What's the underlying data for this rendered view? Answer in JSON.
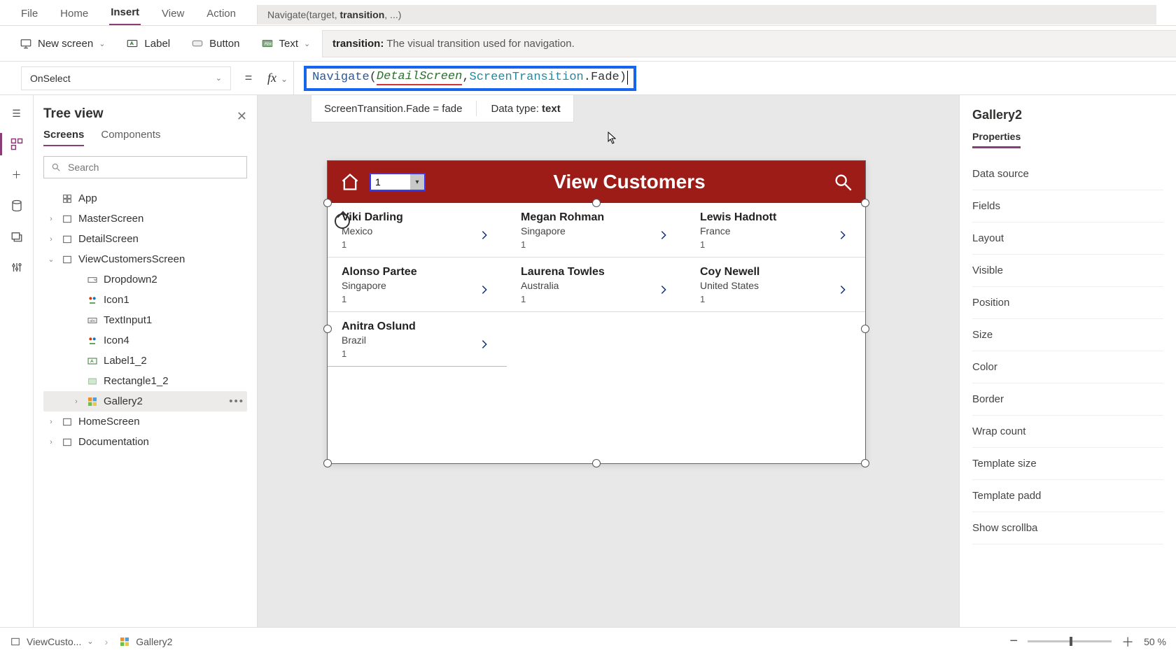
{
  "menu": {
    "file": "File",
    "home": "Home",
    "insert": "Insert",
    "view": "View",
    "action": "Action",
    "active": "insert"
  },
  "fx_signature": {
    "prefix": "Navigate(target, ",
    "bold": "transition",
    "suffix": ", ...)"
  },
  "ribbon": {
    "new_screen": "New screen",
    "label": "Label",
    "button": "Button",
    "text": "Text",
    "tooltip_key": "transition:",
    "tooltip_val": "The visual transition used for navigation."
  },
  "formula": {
    "property": "OnSelect",
    "fx": "fx",
    "tokens": {
      "fn": "Navigate",
      "open": "(",
      "arg1": "DetailScreen",
      "comma": ", ",
      "arg2a": "ScreenTransition",
      "dot": ".",
      "arg2b": "Fade",
      "close": ")"
    },
    "intellisense_left": "ScreenTransition.Fade  =  fade",
    "intellisense_right_label": "Data type: ",
    "intellisense_right_value": "text"
  },
  "tree": {
    "title": "Tree view",
    "tabs": {
      "screens": "Screens",
      "components": "Components"
    },
    "search_placeholder": "Search",
    "app": "App",
    "nodes": {
      "master": "MasterScreen",
      "detail": "DetailScreen",
      "view": "ViewCustomersScreen",
      "children": [
        "Dropdown2",
        "Icon1",
        "TextInput1",
        "Icon4",
        "Label1_2",
        "Rectangle1_2",
        "Gallery2"
      ],
      "home": "HomeScreen",
      "doc": "Documentation"
    },
    "selected": "Gallery2"
  },
  "canvas": {
    "header_title": "View Customers",
    "dropdown_value": "1",
    "customers": [
      {
        "name": "Viki  Darling",
        "sub": "Mexico",
        "num": "1"
      },
      {
        "name": "Megan  Rohman",
        "sub": "Singapore",
        "num": "1"
      },
      {
        "name": "Lewis  Hadnott",
        "sub": "France",
        "num": "1"
      },
      {
        "name": "Alonso  Partee",
        "sub": "Singapore",
        "num": "1"
      },
      {
        "name": "Laurena  Towles",
        "sub": "Australia",
        "num": "1"
      },
      {
        "name": "Coy  Newell",
        "sub": "United States",
        "num": "1"
      },
      {
        "name": "Anitra  Oslund",
        "sub": "Brazil",
        "num": "1"
      }
    ]
  },
  "props": {
    "title": "Gallery2",
    "tab": "Properties",
    "rows": [
      "Data source",
      "Fields",
      "Layout",
      "Visible",
      "Position",
      "Size",
      "Color",
      "Border",
      "Wrap count",
      "Template size",
      "Template padd",
      "Show scrollba"
    ]
  },
  "status": {
    "screen": "ViewCusto...",
    "control": "Gallery2",
    "zoom": "50 %"
  }
}
